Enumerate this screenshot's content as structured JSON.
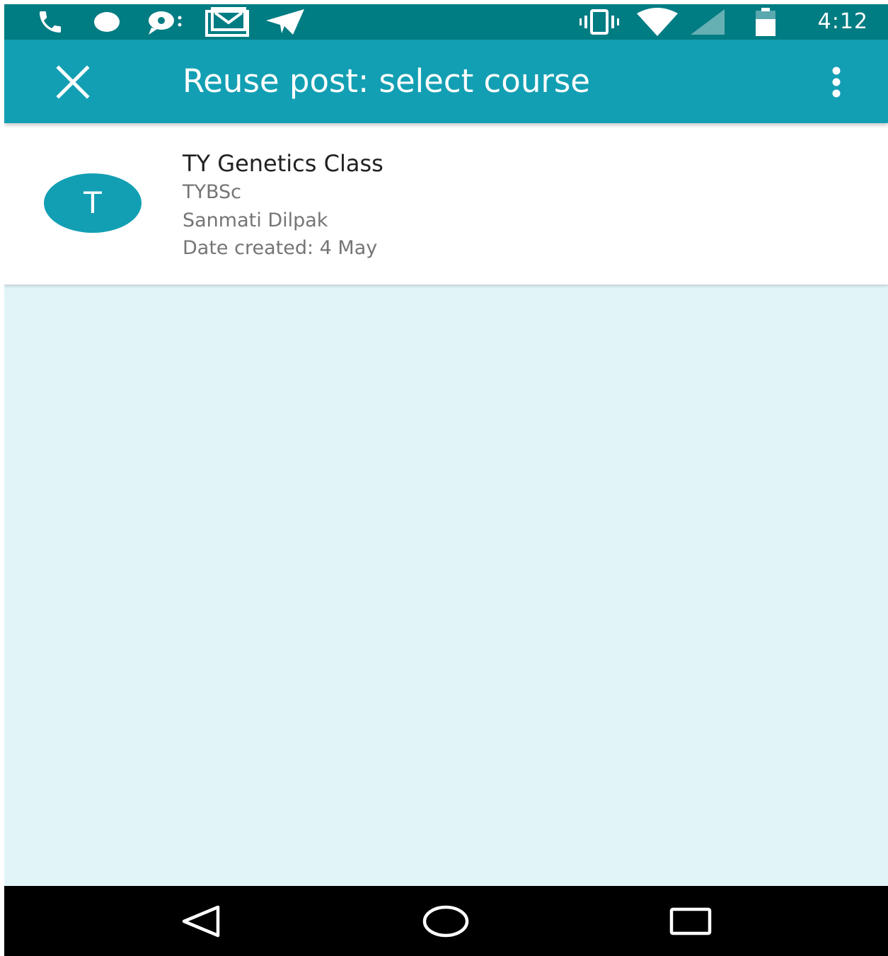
{
  "status_bar": {
    "time": "4:12",
    "left_icons": [
      "phone-icon",
      "dot-icon",
      "chat-bubble-icon",
      "gmail-icon",
      "telegram-icon"
    ],
    "right_icons": [
      "vibrate-icon",
      "wifi-icon",
      "signal-icon",
      "battery-icon"
    ]
  },
  "app_bar": {
    "title": "Reuse post: select course",
    "close_icon": "close-icon",
    "menu_icon": "more-vert-icon"
  },
  "course": {
    "avatar_letter": "T",
    "title": "TY Genetics Class",
    "section": "TYBSc",
    "teacher": "Sanmati Dilpak",
    "date_created": "Date created: 4 May"
  },
  "nav_bar": {
    "icons": [
      "back-icon",
      "home-icon",
      "recents-icon"
    ]
  },
  "colors": {
    "status_bar": "#007c83",
    "app_bar": "#139fb3",
    "avatar": "#139fb3",
    "background": "#e1f5f9",
    "nav_bar": "#000000"
  }
}
